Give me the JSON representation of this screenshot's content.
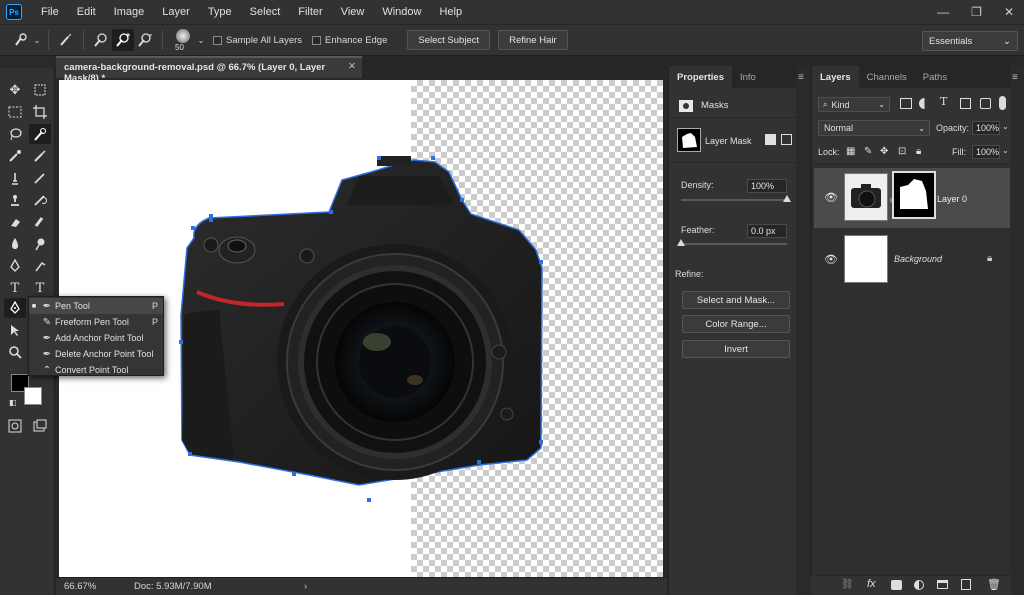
{
  "app": {
    "logo_text": "Ps"
  },
  "menu": [
    "File",
    "Edit",
    "Image",
    "Layer",
    "Type",
    "Select",
    "Filter",
    "View",
    "Window",
    "Help"
  ],
  "window_controls": {
    "minimize": "—",
    "restore": "❐",
    "close": "✕"
  },
  "options_bar": {
    "brush_size": "50",
    "sample_all_layers": "Sample All Layers",
    "enhance_edge": "Enhance Edge",
    "select_subject": "Select Subject",
    "refine_hair": "Refine Hair",
    "workspace": "Essentials"
  },
  "document": {
    "tab_title": "camera-background-removal.psd @ 66.7% (Layer 0, Layer Mask/8) *",
    "zoom": "66.67%",
    "doc_size": "Doc: 5.93M/7.90M"
  },
  "tool_flyout": [
    {
      "label": "Pen Tool",
      "shortcut": "P",
      "selected": true
    },
    {
      "label": "Freeform Pen Tool",
      "shortcut": "P",
      "selected": false
    },
    {
      "label": "Add Anchor Point Tool",
      "shortcut": "",
      "selected": false
    },
    {
      "label": "Delete Anchor Point Tool",
      "shortcut": "",
      "selected": false
    },
    {
      "label": "Convert Point Tool",
      "shortcut": "",
      "selected": false
    }
  ],
  "properties": {
    "tabs": [
      "Properties",
      "Info"
    ],
    "section": "Masks",
    "mask_label": "Layer Mask",
    "density_label": "Density:",
    "density_value": "100%",
    "density_level": 1.0,
    "feather_label": "Feather:",
    "feather_value": "0.0 px",
    "feather_level": 0.0,
    "refine_label": "Refine:",
    "buttons": [
      "Select and Mask...",
      "Color Range...",
      "Invert"
    ]
  },
  "layers_panel": {
    "tabs": [
      "Layers",
      "Channels",
      "Paths"
    ],
    "filter_kind": "Kind",
    "blend_mode": "Normal",
    "opacity_label": "Opacity:",
    "opacity_value": "100%",
    "lock_label": "Lock:",
    "fill_label": "Fill:",
    "fill_value": "100%",
    "layers": [
      {
        "name": "Layer 0",
        "selected": true
      },
      {
        "name": "Background",
        "selected": false
      }
    ]
  },
  "colors": {
    "accent": "#31a8ff",
    "panel_bg": "#323232",
    "selected_layer": "#4b4b4b",
    "path_stroke": "#2f6fe0",
    "lens_ring": "#c0262a"
  }
}
